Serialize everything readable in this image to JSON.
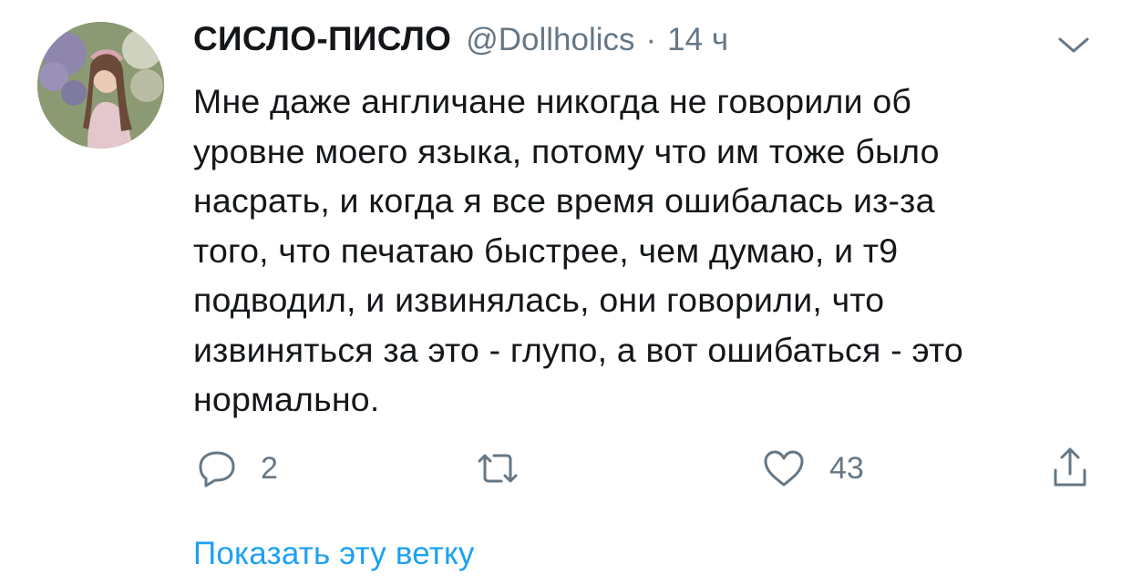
{
  "author": {
    "display_name": "СИСЛО-ПИСЛО",
    "handle": "@Dollholics",
    "separator": "·",
    "time": "14 ч"
  },
  "tweet": {
    "text": "Мне даже англичане никогда не говорили об\nуровне моего языка, потому что им тоже было\nнасрать, и когда я все время ошибалась из-за\nтого, что печатаю быстрее, чем думаю, и т9\nподводил, и извинялась, они говорили, что\nизвиняться за это - глупо, а вот ошибаться - это\nнормально."
  },
  "actions": {
    "reply_count": "2",
    "retweet_count": "",
    "like_count": "43"
  },
  "thread": {
    "show_thread_label": "Показать эту ветку"
  },
  "icons": {
    "reply": "reply-icon",
    "retweet": "retweet-icon",
    "like": "heart-icon",
    "share": "share-icon",
    "more": "chevron-down-icon"
  },
  "colors": {
    "text_primary": "#14171a",
    "text_secondary": "#657786",
    "link": "#1da1f2"
  }
}
